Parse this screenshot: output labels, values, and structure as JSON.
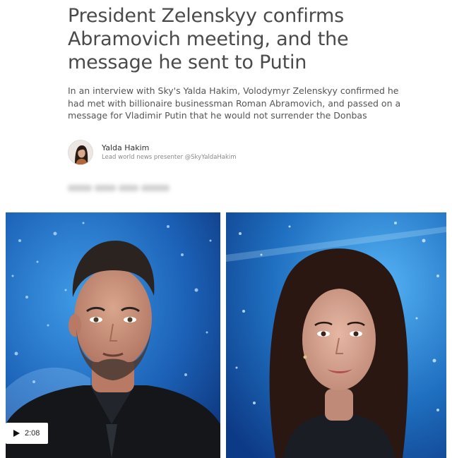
{
  "article": {
    "headline_lines": [
      "President Zelenskyy confirms",
      "Abramovich meeting, and the",
      "message he sent to Putin"
    ],
    "standfirst_lines": [
      "In an interview with Sky's Yalda Hakim, Volodymyr Zelenskyy confirmed he",
      "had met with billionaire businessman Roman Abramovich, and passed on a",
      "message for Vladimir Putin that he would not surrender the Donbas"
    ]
  },
  "byline": {
    "author_name": "Yalda Hakim",
    "author_role": "Lead world news presenter @SkyYaldaHakim"
  },
  "video": {
    "duration": "2:08",
    "play_icon": "play-icon"
  },
  "colors": {
    "headline": "#4a4a4a",
    "studio_blue": "#1f6fc0",
    "background": "#ffffff"
  }
}
